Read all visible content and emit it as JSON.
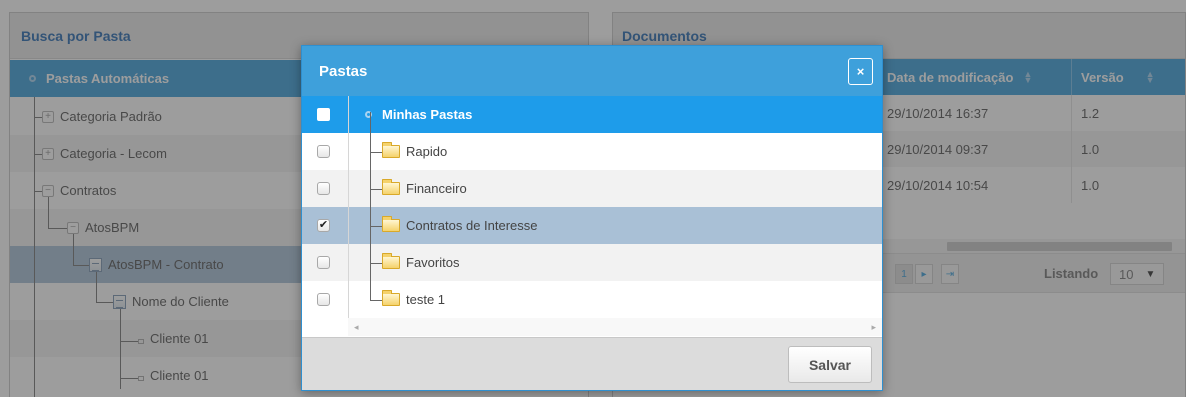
{
  "left_panel": {
    "title": "Busca por Pasta",
    "root": "Pastas Automáticas",
    "items": [
      {
        "label": "Categoria Padrão",
        "toggle": "+"
      },
      {
        "label": "Categoria - Lecom",
        "toggle": "+"
      },
      {
        "label": "Contratos",
        "toggle": "−"
      },
      {
        "label": "AtosBPM",
        "toggle": "−"
      },
      {
        "label": "AtosBPM - Contrato"
      },
      {
        "label": "Nome do Cliente"
      },
      {
        "label": "Cliente 01"
      },
      {
        "label": "Cliente 01"
      }
    ]
  },
  "right_panel": {
    "title": "Documentos",
    "columns": [
      "Data de modificação",
      "Versão"
    ],
    "rows": [
      [
        "29/10/2014 16:37",
        "1.2"
      ],
      [
        "29/10/2014 09:37",
        "1.0"
      ],
      [
        "29/10/2014 10:54",
        "1.0"
      ]
    ],
    "pager": {
      "current_page": "1",
      "listing_label": "Listando",
      "page_size": "10"
    }
  },
  "modal": {
    "title": "Pastas",
    "close_glyph": "×",
    "root": "Minhas Pastas",
    "folders": [
      {
        "label": "Rapido",
        "checked": false
      },
      {
        "label": "Financeiro",
        "checked": false
      },
      {
        "label": "Contratos de Interesse",
        "checked": true
      },
      {
        "label": "Favoritos",
        "checked": false
      },
      {
        "label": "teste 1",
        "checked": false
      }
    ],
    "save_label": "Salvar",
    "check_glyph": "✔"
  },
  "colors": {
    "accent": "#3ea0db",
    "selected_row": "#a9c0d6",
    "title_blue": "#2b6cb3"
  }
}
